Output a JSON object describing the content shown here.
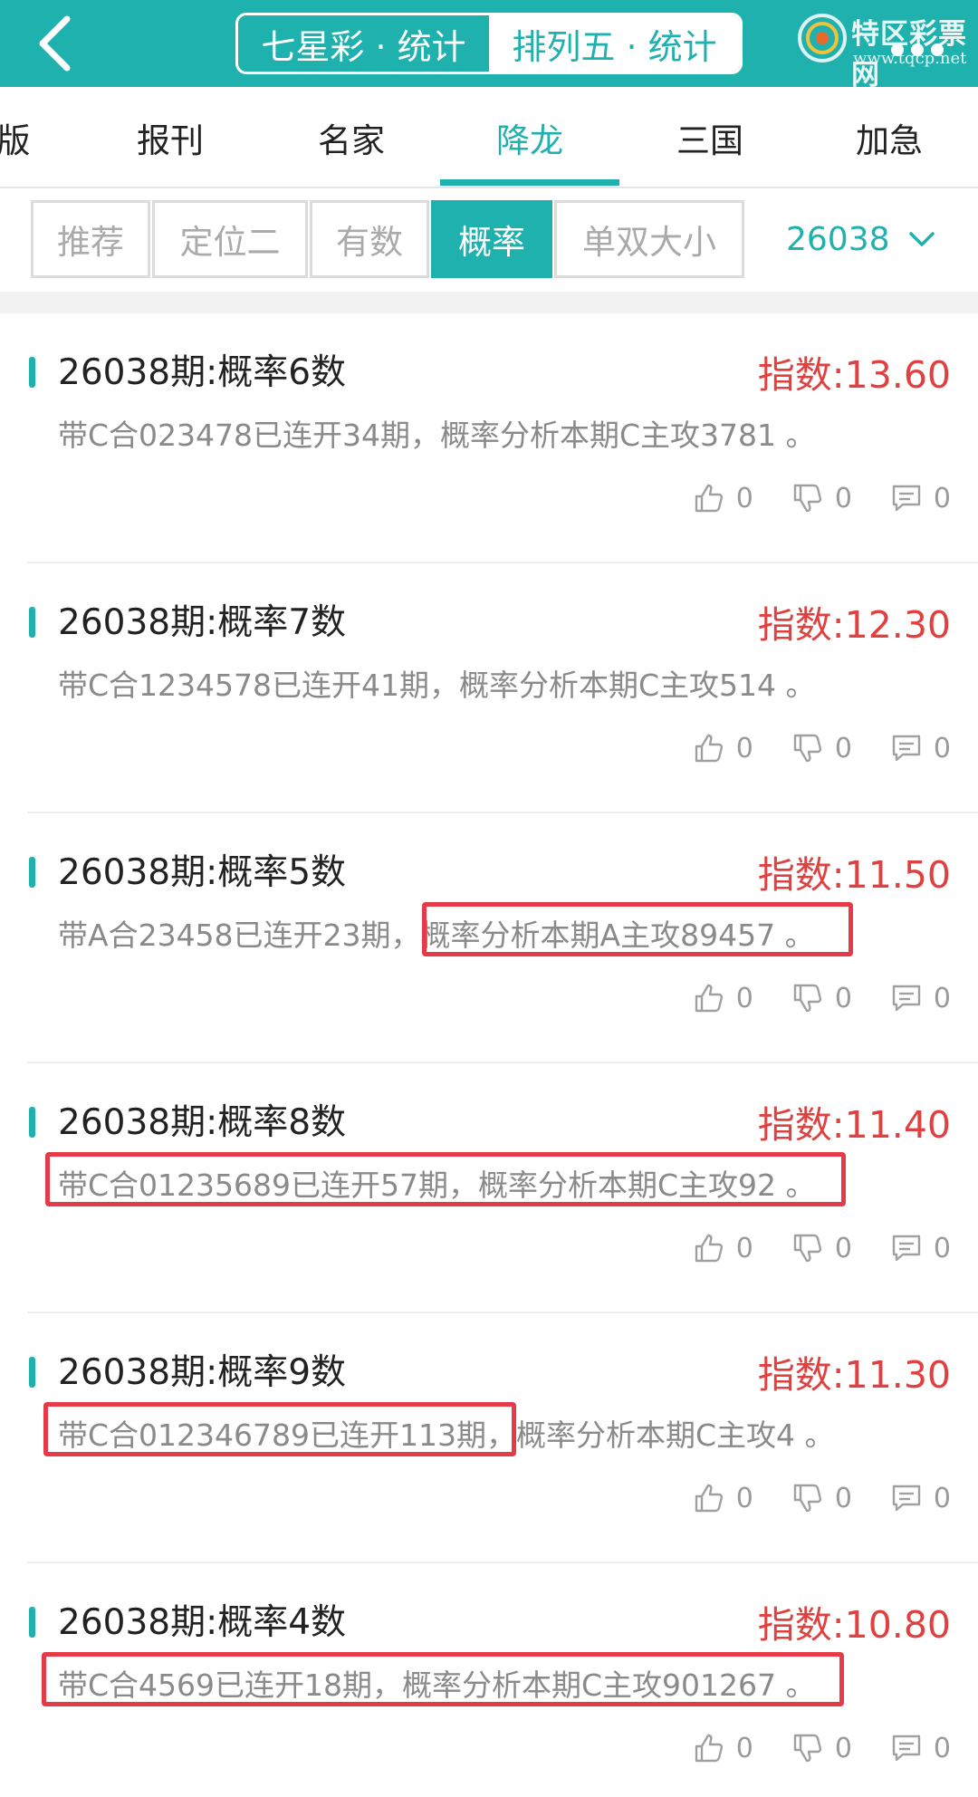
{
  "header": {
    "segments": [
      {
        "label": "七星彩 · 统计",
        "active": false
      },
      {
        "label": "排列五 · 统计",
        "active": true
      }
    ],
    "logo_text": "特区彩票网",
    "logo_sub": "www.tqcp.net",
    "accent": "#1fb1ad"
  },
  "category_tabs": [
    {
      "label": "版",
      "active": false
    },
    {
      "label": "报刊",
      "active": false
    },
    {
      "label": "名家",
      "active": false
    },
    {
      "label": "降龙",
      "active": true
    },
    {
      "label": "三国",
      "active": false
    },
    {
      "label": "加急",
      "active": false
    }
  ],
  "sub_tabs": [
    {
      "label": "推荐",
      "active": false
    },
    {
      "label": "定位二",
      "active": false
    },
    {
      "label": "有数",
      "active": false
    },
    {
      "label": "概率",
      "active": true
    },
    {
      "label": "单双大小",
      "active": false
    }
  ],
  "period": "26038",
  "cards": [
    {
      "title": "26038期:概率6数",
      "index": "指数:13.60",
      "desc": "带C合023478已连开34期，概率分析本期C主攻3781 。",
      "likes": "0",
      "dislikes": "0",
      "comments": "0"
    },
    {
      "title": "26038期:概率7数",
      "index": "指数:12.30",
      "desc": "带C合1234578已连开41期，概率分析本期C主攻514 。",
      "likes": "0",
      "dislikes": "0",
      "comments": "0"
    },
    {
      "title": "26038期:概率5数",
      "index": "指数:11.50",
      "desc": "带A合23458已连开23期，概率分析本期A主攻89457 。",
      "likes": "0",
      "dislikes": "0",
      "comments": "0"
    },
    {
      "title": "26038期:概率8数",
      "index": "指数:11.40",
      "desc": "带C合01235689已连开57期，概率分析本期C主攻92 。",
      "likes": "0",
      "dislikes": "0",
      "comments": "0"
    },
    {
      "title": "26038期:概率9数",
      "index": "指数:11.30",
      "desc": "带C合012346789已连开113期，概率分析本期C主攻4 。",
      "likes": "0",
      "dislikes": "0",
      "comments": "0"
    },
    {
      "title": "26038期:概率4数",
      "index": "指数:10.80",
      "desc": "带C合4569已连开18期，概率分析本期C主攻901267 。",
      "likes": "0",
      "dislikes": "0",
      "comments": "0"
    }
  ],
  "colors": {
    "index_red": "#e04040",
    "highlight_red": "#e53a47"
  }
}
